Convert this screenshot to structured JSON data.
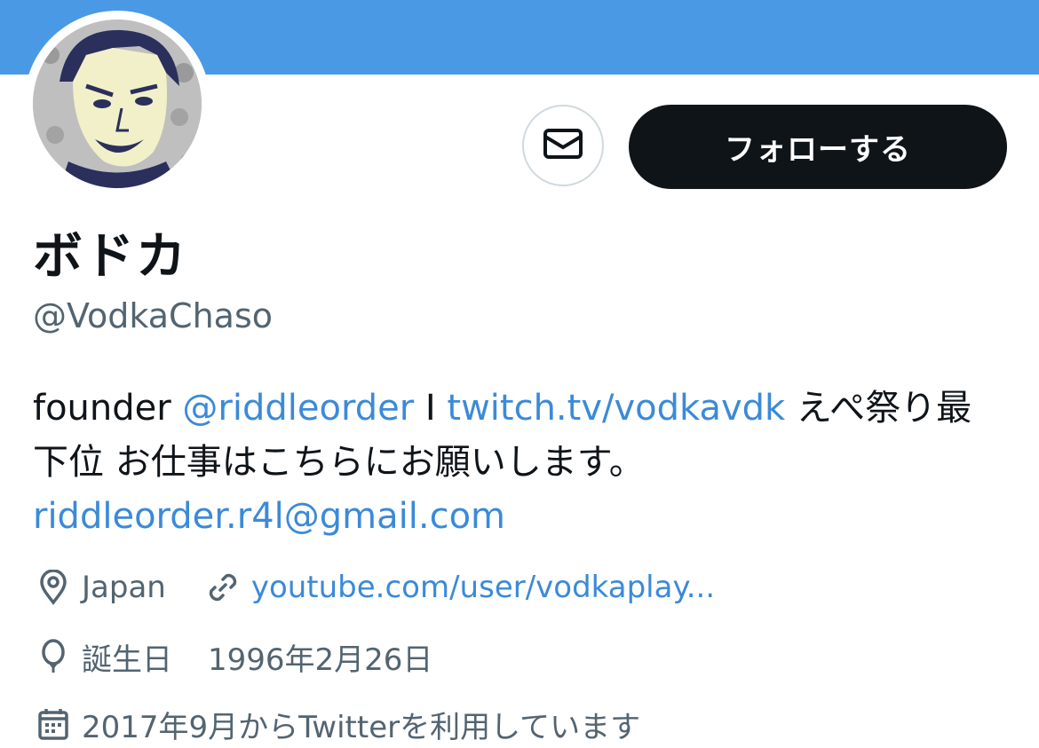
{
  "header": {
    "banner_color": "#4a99e4"
  },
  "actions": {
    "message_icon": "envelope-icon",
    "follow_label": "フォローする"
  },
  "profile": {
    "display_name": "ボドカ",
    "handle": "@VodkaChaso"
  },
  "bio": {
    "prefix": "founder ",
    "mention": "@riddleorder",
    "separator": " I ",
    "twitch_link": "twitch.tv/vodkavdk",
    "line1_suffix": " えぺ祭り最",
    "line2": "下位 お仕事はこちらにお願いします。",
    "email": "riddleorder.r4l@gmail.com"
  },
  "meta": {
    "location_icon": "location-pin-icon",
    "location": "Japan",
    "website_icon": "link-icon",
    "website": "youtube.com/user/vodkaplay...",
    "birthday_icon": "balloon-icon",
    "birthday_label": "誕生日",
    "birthday_value": "1996年2月26日",
    "joined_icon": "calendar-icon",
    "joined": "2017年9月からTwitterを利用しています"
  },
  "colors": {
    "link": "#3b8ad8",
    "secondary_text": "#536471",
    "button_dark": "#0f1419"
  }
}
